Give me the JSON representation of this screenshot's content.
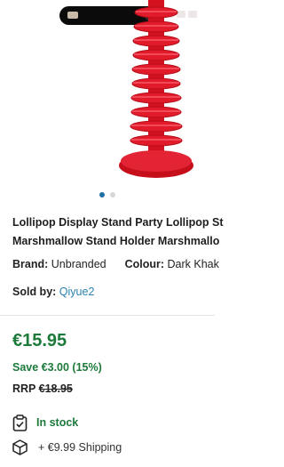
{
  "product": {
    "title_line1": "Lollipop Display Stand Party Lollipop St",
    "title_line2": "Marshmallow Stand Holder Marshmallo",
    "brand_label": "Brand:",
    "brand_value": "Unbranded",
    "colour_label": "Colour:",
    "colour_value": "Dark Khak",
    "sold_by_label": "Sold by:",
    "seller": "Qiyue2"
  },
  "pricing": {
    "price": "€15.95",
    "save": "Save €3.00 (15%)",
    "rrp_label": "RRP",
    "rrp_value": "€18.95"
  },
  "availability": {
    "stock": "In stock",
    "shipping": "+ €9.99 Shipping"
  },
  "carousel": {
    "total": 2,
    "active_index": 0
  },
  "icons": {
    "stock": "clipboard-check-icon",
    "shipping": "package-box-icon"
  },
  "colors": {
    "price_green": "#1c7a3a",
    "link_blue": "#2a82b5",
    "stand_red": "#e11b2b"
  }
}
